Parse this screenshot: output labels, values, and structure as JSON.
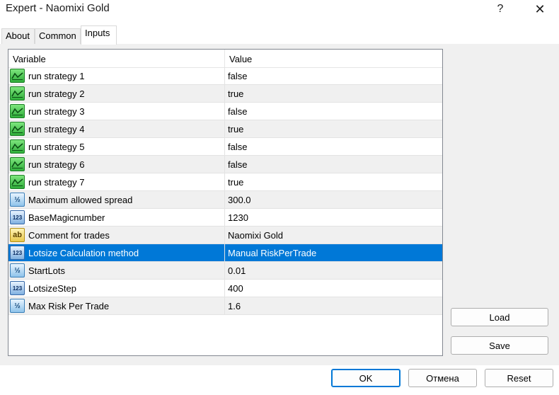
{
  "window": {
    "title": "Expert - Naomixi Gold",
    "help_label": "?",
    "close_label": "✕"
  },
  "tabs": [
    {
      "label": "About"
    },
    {
      "label": "Common"
    },
    {
      "label": "Inputs"
    }
  ],
  "active_tab": "Inputs",
  "grid": {
    "columns": {
      "variable": "Variable",
      "value": "Value"
    },
    "rows": [
      {
        "type": "bool",
        "icon_text": "",
        "variable": "run strategy 1",
        "value": "false"
      },
      {
        "type": "bool",
        "icon_text": "",
        "variable": "run strategy 2",
        "value": "true"
      },
      {
        "type": "bool",
        "icon_text": "",
        "variable": "run strategy 3",
        "value": "false"
      },
      {
        "type": "bool",
        "icon_text": "",
        "variable": "run strategy 4",
        "value": "true"
      },
      {
        "type": "bool",
        "icon_text": "",
        "variable": "run strategy 5",
        "value": "false"
      },
      {
        "type": "bool",
        "icon_text": "",
        "variable": "run strategy 6",
        "value": "false"
      },
      {
        "type": "bool",
        "icon_text": "",
        "variable": "run strategy 7",
        "value": "true"
      },
      {
        "type": "double",
        "icon_text": "½",
        "variable": "Maximum allowed spread",
        "value": "300.0"
      },
      {
        "type": "int",
        "icon_text": "123",
        "variable": "BaseMagicnumber",
        "value": "1230"
      },
      {
        "type": "string",
        "icon_text": "ab",
        "variable": "Comment for trades",
        "value": "Naomixi Gold"
      },
      {
        "type": "int",
        "icon_text": "123",
        "variable": "Lotsize Calculation method",
        "value": "Manual RiskPerTrade",
        "selected": true
      },
      {
        "type": "double",
        "icon_text": "½",
        "variable": "StartLots",
        "value": "0.01"
      },
      {
        "type": "int",
        "icon_text": "123",
        "variable": "LotsizeStep",
        "value": "400"
      },
      {
        "type": "double",
        "icon_text": "½",
        "variable": "Max Risk Per Trade",
        "value": "1.6"
      }
    ]
  },
  "buttons": {
    "load": "Load",
    "save": "Save",
    "ok": "OK",
    "cancel": "Отмена",
    "reset": "Reset"
  },
  "colors": {
    "selection": "#0078d7",
    "alt_row": "#f0f0f0"
  }
}
